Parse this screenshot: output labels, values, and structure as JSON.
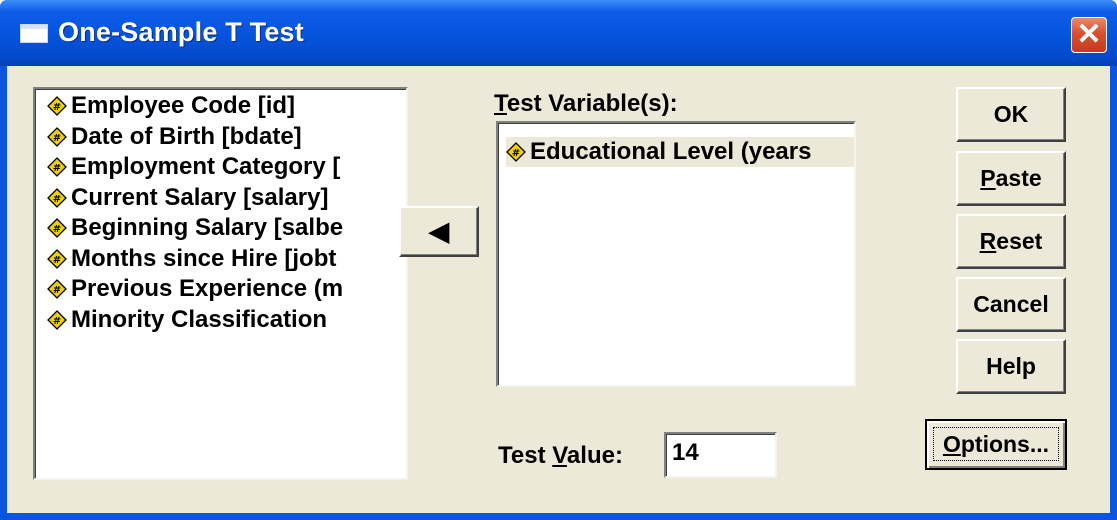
{
  "window": {
    "title": "One-Sample T Test",
    "close_symbol": "✕"
  },
  "source_list": {
    "items": [
      {
        "label": "Employee Code [id]",
        "icon": "numeric-variable-icon"
      },
      {
        "label": "Date of Birth [bdate]",
        "icon": "numeric-variable-icon"
      },
      {
        "label": "Employment Category [",
        "icon": "numeric-variable-icon"
      },
      {
        "label": "Current Salary [salary]",
        "icon": "numeric-variable-icon"
      },
      {
        "label": "Beginning Salary [salbe",
        "icon": "numeric-variable-icon"
      },
      {
        "label": "Months since Hire [jobt",
        "icon": "numeric-variable-icon"
      },
      {
        "label": "Previous Experience (m",
        "icon": "numeric-variable-icon"
      },
      {
        "label": "Minority Classification",
        "icon": "numeric-variable-icon"
      }
    ]
  },
  "move_button": {
    "icon": "left-arrow-icon",
    "symbol": "◀"
  },
  "test_variables": {
    "label_pre": "",
    "label_mnemonic": "T",
    "label_post": "est Variable(s):",
    "items": [
      {
        "label": "Educational Level (years",
        "icon": "numeric-variable-icon"
      }
    ]
  },
  "test_value": {
    "label_pre": "Test ",
    "label_mnemonic": "V",
    "label_post": "alue:",
    "value": "14"
  },
  "buttons": {
    "ok": {
      "label": "OK"
    },
    "paste": {
      "mnemonic": "P",
      "rest": "aste"
    },
    "reset": {
      "mnemonic": "R",
      "rest": "eset"
    },
    "cancel": {
      "label": "Cancel"
    },
    "help": {
      "label": "Help"
    },
    "options": {
      "mnemonic": "O",
      "rest": "ptions..."
    }
  },
  "colors": {
    "titlebar": "#0453dd",
    "dialog_bg": "#ece9d8",
    "close_button": "#d8502f",
    "selection": "#ece9d8",
    "variable_icon": "#f1d000"
  }
}
